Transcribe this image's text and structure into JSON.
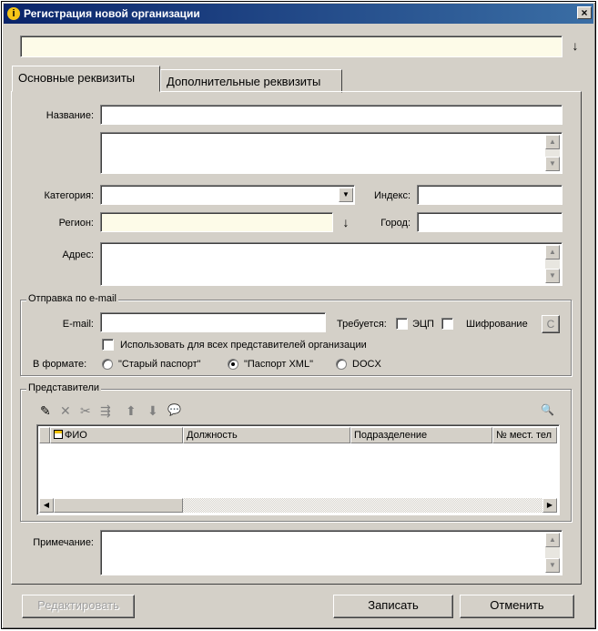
{
  "window": {
    "title": "Регистрация новой организации",
    "close": "×"
  },
  "tabs": [
    {
      "label": "Основные реквизиты"
    },
    {
      "label": "Дополнительные реквизиты"
    }
  ],
  "form": {
    "name_label": "Название:",
    "category_label": "Категория:",
    "index_label": "Индекс:",
    "region_label": "Регион:",
    "city_label": "Город:",
    "address_label": "Адрес:",
    "note_label": "Примечание:"
  },
  "email_group": {
    "legend": "Отправка по e-mail",
    "email_label": "E-mail:",
    "requires_label": "Требуется:",
    "ecp_label": "ЭЦП",
    "encrypt_label": "Шифрование",
    "encrypt_btn": "C",
    "use_all_label": "Использовать для всех представителей организации",
    "format_label": "В формате:",
    "formats": [
      {
        "label": "\"Старый паспорт\"",
        "selected": false
      },
      {
        "label": "\"Паспорт XML\"",
        "selected": true
      },
      {
        "label": "DOCX",
        "selected": false
      }
    ]
  },
  "representatives": {
    "legend": "Представители",
    "columns": [
      "ФИО",
      "Должность",
      "Подразделение",
      "№ мест. тел"
    ]
  },
  "icons": {
    "pick": "↓",
    "down": "▼",
    "up": "▲",
    "left": "◀",
    "right": "▶",
    "tool_new": "✎",
    "tool_delete": "✕",
    "tool_cut": "✂",
    "tool_merge": "⇶",
    "tool_up": "⬆",
    "tool_down": "⬇",
    "tool_comment": "💬",
    "tool_search": "🔍"
  },
  "buttons": {
    "edit": "Редактировать",
    "save": "Записать",
    "cancel": "Отменить"
  }
}
